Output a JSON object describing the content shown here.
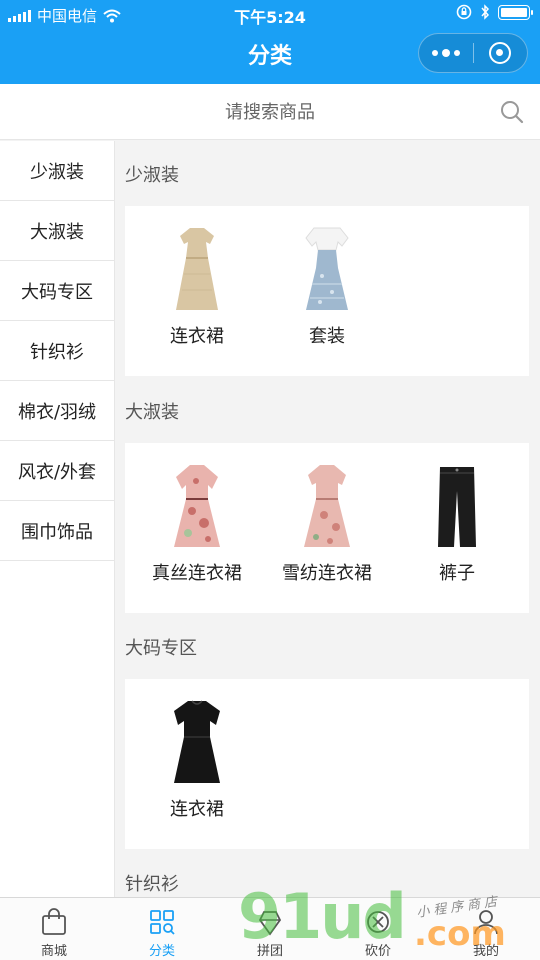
{
  "status_bar": {
    "carrier": "中国电信",
    "time": "下午5:24",
    "battery_level": 1.0
  },
  "nav": {
    "title": "分类"
  },
  "search": {
    "placeholder": "请搜索商品"
  },
  "sidebar": {
    "items": [
      {
        "label": "少淑装"
      },
      {
        "label": "大淑装"
      },
      {
        "label": "大码专区"
      },
      {
        "label": "针织衫"
      },
      {
        "label": "棉衣/羽绒"
      },
      {
        "label": "风衣/外套"
      },
      {
        "label": "围巾饰品"
      }
    ]
  },
  "sections": [
    {
      "title": "少淑装",
      "products": [
        {
          "name": "连衣裙",
          "icon": "beige-dress-image"
        },
        {
          "name": "套装",
          "icon": "blue-dress-set-image"
        }
      ]
    },
    {
      "title": "大淑装",
      "products": [
        {
          "name": "真丝连衣裙",
          "icon": "pink-floral-dress-image"
        },
        {
          "name": "雪纺连衣裙",
          "icon": "pink-chiffon-dress-image"
        },
        {
          "name": "裤子",
          "icon": "black-pants-image"
        }
      ]
    },
    {
      "title": "大码专区",
      "products": [
        {
          "name": "连衣裙",
          "icon": "black-dress-image"
        }
      ]
    },
    {
      "title": "针织衫",
      "products": []
    }
  ],
  "tabbar": {
    "tabs": [
      {
        "label": "商城",
        "icon": "shopping-bag-icon"
      },
      {
        "label": "分类",
        "icon": "category-grid-icon"
      },
      {
        "label": "拼团",
        "icon": "group-buy-icon"
      },
      {
        "label": "砍价",
        "icon": "bargain-icon"
      },
      {
        "label": "我的",
        "icon": "user-icon"
      }
    ],
    "active_tab": "分类"
  },
  "watermark": {
    "main": "91ud",
    "suffix": ".com",
    "tagline": "小程序商店"
  },
  "colors": {
    "brand_blue": "#1aa0f5",
    "watermark_green": "#46be3c",
    "watermark_orange": "#ff961e"
  }
}
